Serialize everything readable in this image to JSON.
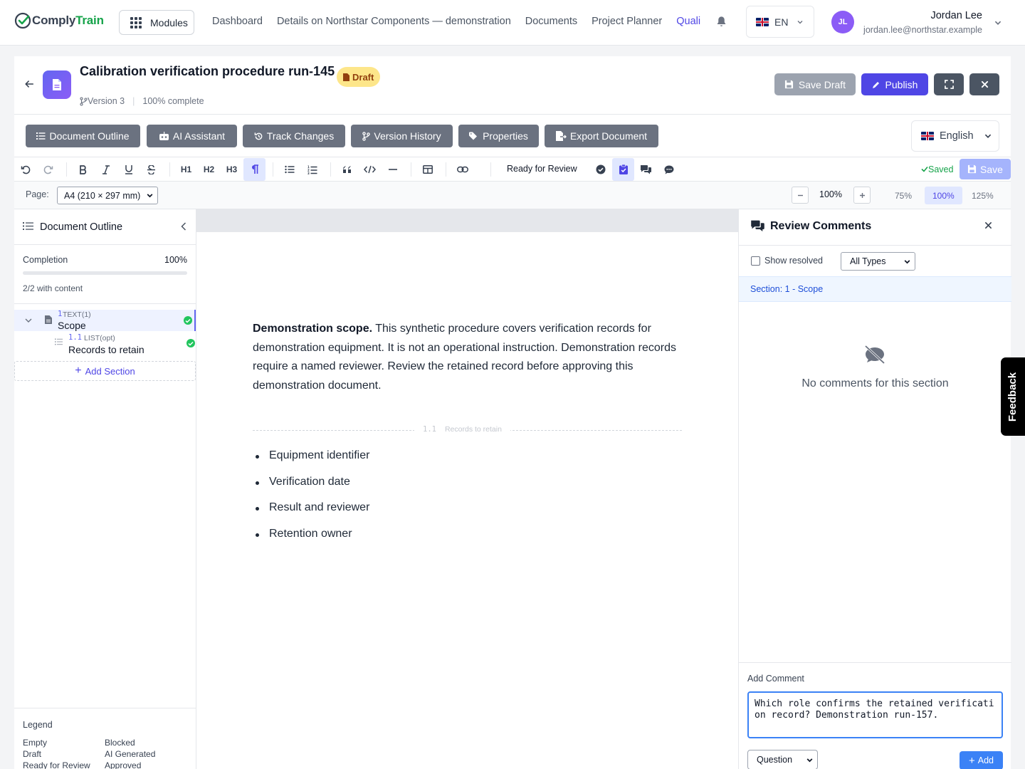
{
  "app": {
    "logo_part1": "Comply",
    "logo_part2": "Train"
  },
  "nav": {
    "modules_label": "Modules",
    "links": [
      "Dashboard",
      "Details on Northstar Components — demonstration",
      "Documents",
      "Project Planner"
    ],
    "active_link": "Quali",
    "language": "EN"
  },
  "user": {
    "initials": "JL",
    "name": "Jordan Lee",
    "email": "jordan.lee@northstar.example"
  },
  "document": {
    "title": "Calibration verification procedure run-145",
    "status": "Draft",
    "version": "Version 3",
    "completion_text": "100% complete",
    "actions": {
      "save_draft": "Save Draft",
      "publish": "Publish"
    }
  },
  "panels": {
    "buttons": [
      "Document Outline",
      "AI Assistant",
      "Track Changes",
      "Version History",
      "Properties",
      "Export Document"
    ],
    "language": "English"
  },
  "toolbar": {
    "headings": [
      "H1",
      "H2",
      "H3"
    ],
    "status": "Ready for Review",
    "saved_label": "Saved",
    "save_label": "Save"
  },
  "pagebar": {
    "page_label": "Page:",
    "page_size": "A4 (210 × 297 mm)",
    "zoom": "100%",
    "presets": [
      "75%",
      "100%",
      "125%"
    ],
    "active_preset": "100%"
  },
  "outline": {
    "title": "Document Outline",
    "completion_label": "Completion",
    "completion_value": "100%",
    "completion_fraction": 1.0,
    "with_content": "2/2 with content",
    "sections": [
      {
        "number": "1",
        "type": "TEXT(1)",
        "name": "Scope"
      },
      {
        "number": "1.1",
        "type": "LIST(opt)",
        "name": "Records to retain"
      }
    ],
    "add_section": "Add Section",
    "legend_title": "Legend",
    "legend": [
      "Empty",
      "Blocked",
      "Draft",
      "AI Generated",
      "Ready for Review",
      "Approved"
    ]
  },
  "editor": {
    "scope_bold": "Demonstration scope.",
    "scope_text": " This synthetic procedure covers verification records for demonstration equipment. It is not an operational instruction. Demonstration records require a named reviewer. Review the retained record before approving this demonstration document.",
    "divider_number": "1.1",
    "divider_name": "Records to retain",
    "bullets": [
      "Equipment identifier",
      "Verification date",
      "Result and reviewer",
      "Retention owner"
    ]
  },
  "comments": {
    "title": "Review Comments",
    "show_resolved": "Show resolved",
    "type_filter": "All Types",
    "section_label": "Section: 1 - Scope",
    "empty_text": "No comments for this section",
    "add_label": "Add Comment",
    "draft_text": "Which role confirms the retained verification record? Demonstration run-157.",
    "comment_type": "Question",
    "add_button": "Add"
  },
  "feedback_label": "Feedback",
  "colors": {
    "accent": "#4f46e5",
    "success": "#22c55e",
    "draft_badge": "#fde68a"
  }
}
